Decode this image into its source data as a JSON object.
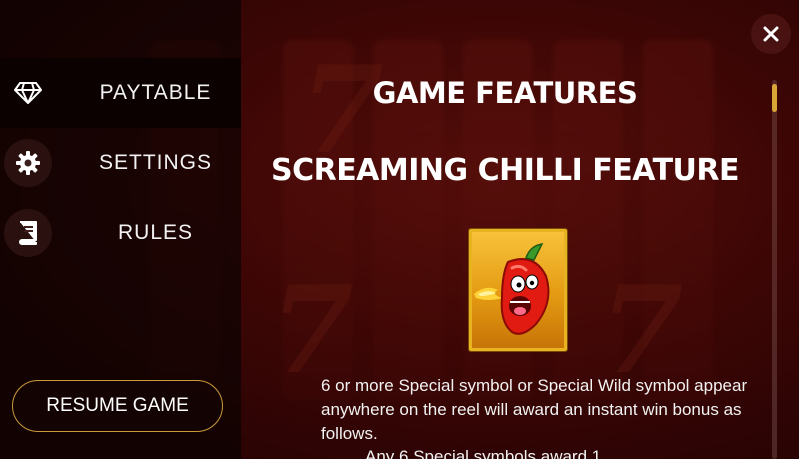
{
  "menu": {
    "items": [
      {
        "label": "PAYTABLE",
        "icon": "diamond-icon",
        "active": true
      },
      {
        "label": "SETTINGS",
        "icon": "gear-icon",
        "active": false
      },
      {
        "label": "RULES",
        "icon": "book-icon",
        "active": false
      }
    ],
    "resume_label": "RESUME GAME"
  },
  "content": {
    "title": "GAME FEATURES",
    "feature_title": "SCREAMING CHILLI FEATURE",
    "symbol_icon": "screaming-chilli-symbol",
    "description": "6 or more Special symbol or Special Wild symbol appear anywhere on the reel will award an instant win bonus as follows.",
    "list_first_partial": "Any 6 Special symbols award 1..."
  },
  "controls": {
    "close_icon": "close-icon"
  },
  "colors": {
    "accent_gold": "#d8a634",
    "frame_gold": "#e8b321",
    "panel_bg": "#2a0404"
  }
}
